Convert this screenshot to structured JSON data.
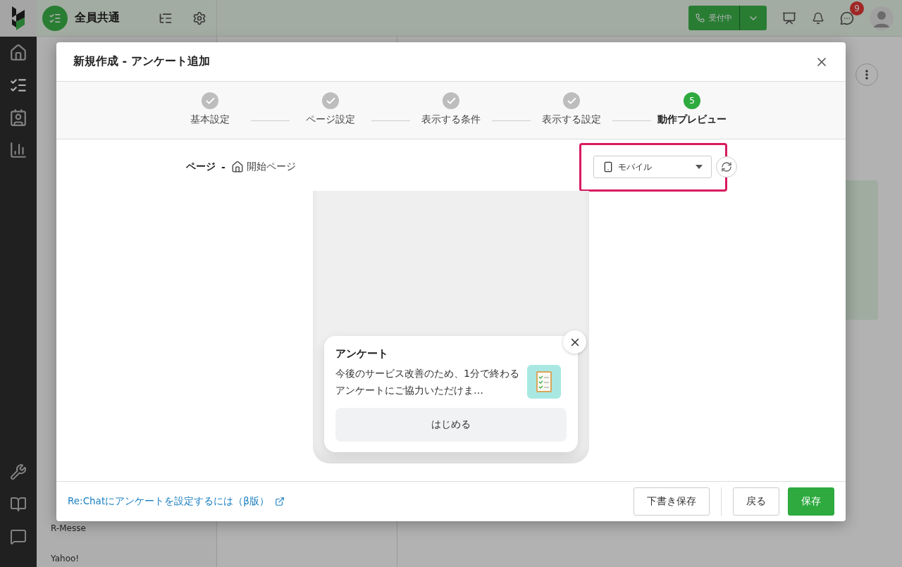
{
  "app_bar": {
    "workspace": "全員共通",
    "status_button": "受付中",
    "notification_count": "9"
  },
  "sidebar": {
    "items": [
      {
        "label": "R-Messe"
      },
      {
        "label": "Yahoo!"
      }
    ]
  },
  "dialog": {
    "title": "新規作成 - アンケート追加",
    "steps": [
      {
        "label": "基本設定",
        "completed": true,
        "selected": false
      },
      {
        "label": "ページ設定",
        "completed": true,
        "selected": false
      },
      {
        "label": "表示する条件",
        "completed": true,
        "selected": false
      },
      {
        "label": "表示する設定",
        "completed": true,
        "selected": false
      },
      {
        "label": "動作プレビュー",
        "completed": false,
        "selected": true,
        "number": "5"
      }
    ],
    "page_label": "ページ",
    "page_separator": "-",
    "page_name": "開始ページ",
    "device": {
      "value": "モバイル",
      "highlighted": true
    },
    "survey": {
      "title": "アンケート",
      "body": "今後のサービス改善のため、1分で終わるアンケートにご協力いただけま…",
      "start_button": "はじめる"
    },
    "help_link": "Re:Chatにアンケートを設定するには（β版）",
    "buttons": [
      {
        "label": "下書き保存",
        "kind": "secondary"
      },
      {
        "label": "戻る",
        "kind": "secondary"
      },
      {
        "label": "保存",
        "kind": "primary"
      }
    ]
  }
}
